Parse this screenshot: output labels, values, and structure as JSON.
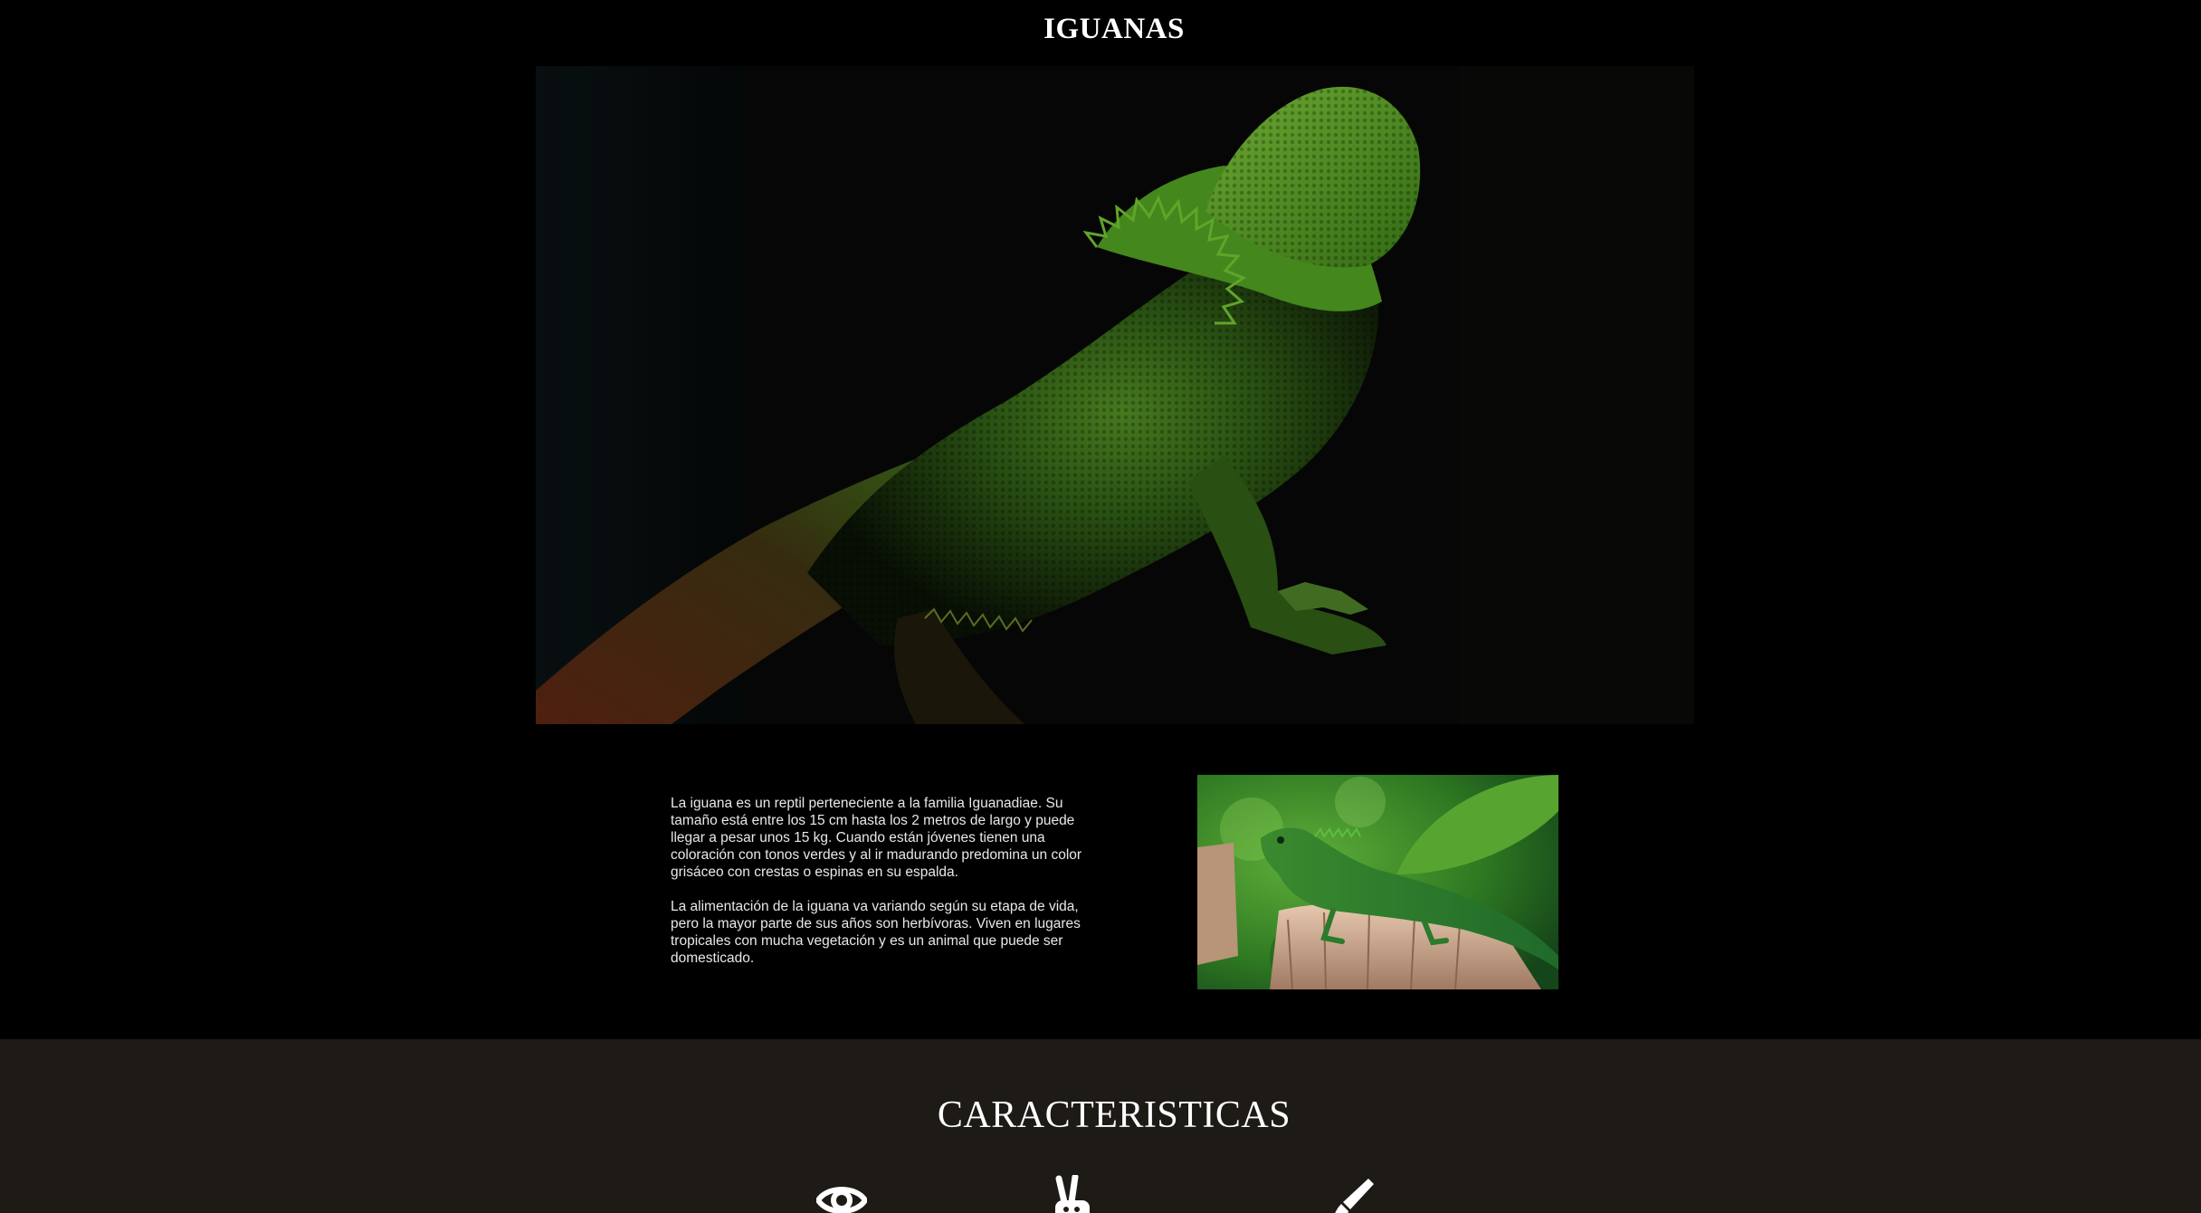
{
  "header": {
    "title": "IGUANAS"
  },
  "intro": {
    "paragraph_1": "La iguana es un reptil perteneciente a la familia Iguanadiae. Su tamaño está entre los 15 cm hasta los 2 metros de largo y puede llegar a pesar unos 15 kg. Cuando están jóvenes tienen una coloración con tonos verdes y al ir madurando predomina un color grisáceo con crestas o espinas en su espalda.",
    "paragraph_2": "La alimentación de la iguana va variando según su etapa de vida, pero la mayor parte de sus años son herbívoras. Viven en lugares tropicales con mucha vegetación y es un animal que puede ser domesticado."
  },
  "features": {
    "title": "CARACTERISTICAS",
    "icons": [
      "eye-icon",
      "peace-hand-icon",
      "paintbrush-icon"
    ]
  },
  "colors": {
    "page_background": "#000000",
    "features_background": "#1e1a16",
    "text": "#ffffff"
  }
}
